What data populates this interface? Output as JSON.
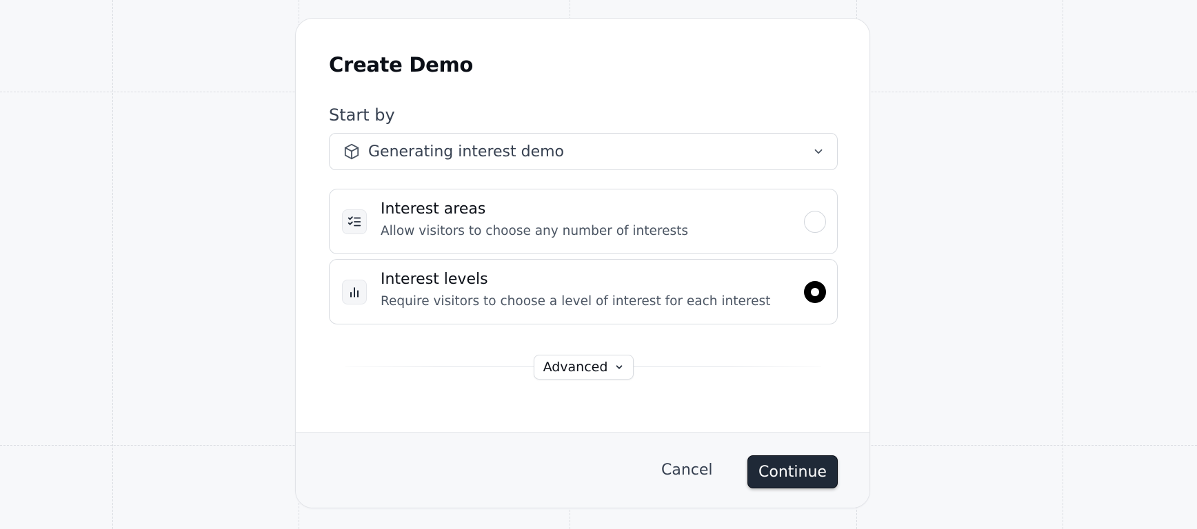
{
  "dialog": {
    "title": "Create Demo",
    "start_by": {
      "label": "Start by",
      "selected": "Generating interest demo",
      "icon": "cube-icon"
    },
    "options": [
      {
        "title": "Interest areas",
        "description": "Allow visitors to choose any number of interests",
        "icon": "checklist-icon",
        "selected": false
      },
      {
        "title": "Interest levels",
        "description": "Require visitors to choose a level of interest for each interest",
        "icon": "bar-chart-icon",
        "selected": true
      }
    ],
    "advanced_label": "Advanced",
    "footer": {
      "cancel_label": "Cancel",
      "continue_label": "Continue"
    }
  },
  "colors": {
    "background": "#f7f8fa",
    "primary_button": "#1f2937",
    "border": "#d9dce1",
    "text_primary": "#0b0f17",
    "text_secondary": "#4b5563"
  }
}
